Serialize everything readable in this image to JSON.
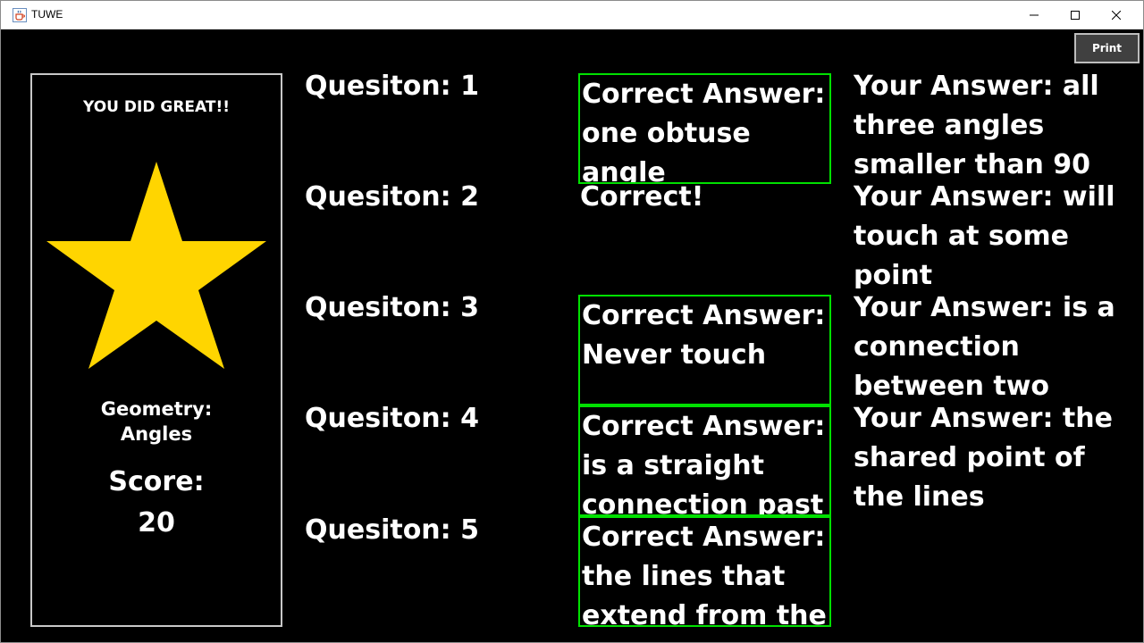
{
  "window": {
    "title": "TUWE",
    "icon": "java-cup-icon"
  },
  "toolbar": {
    "print_label": "Print"
  },
  "result": {
    "message": "YOU DID GREAT!!",
    "subject_line1": "Geometry:",
    "subject_line2": "Angles",
    "score_label": "Score:",
    "score_value": "20",
    "star_color": "#FFD500"
  },
  "colors": {
    "background": "#000000",
    "correct_border": "#00E000",
    "text": "#FFFFFF"
  },
  "questions": [
    {
      "label": "Quesiton: 1",
      "status": "incorrect",
      "correct_answer": "Correct Answer: one obtuse angle",
      "your_answer": "Your Answer: all three angles smaller than 90"
    },
    {
      "label": "Quesiton: 2",
      "status": "correct",
      "correct_text": "Correct!",
      "your_answer": "Your Answer: will touch at some point"
    },
    {
      "label": "Quesiton: 3",
      "status": "incorrect",
      "correct_answer": "Correct Answer: Never touch",
      "your_answer": "Your Answer: is a connection between two"
    },
    {
      "label": "Quesiton: 4",
      "status": "incorrect",
      "correct_answer": "Correct Answer: is a straight connection past",
      "your_answer": "Your Answer: the shared point of the lines"
    },
    {
      "label": "Quesiton: 5",
      "status": "incorrect",
      "correct_answer": "Correct Answer: the lines that extend from the",
      "your_answer": ""
    }
  ]
}
